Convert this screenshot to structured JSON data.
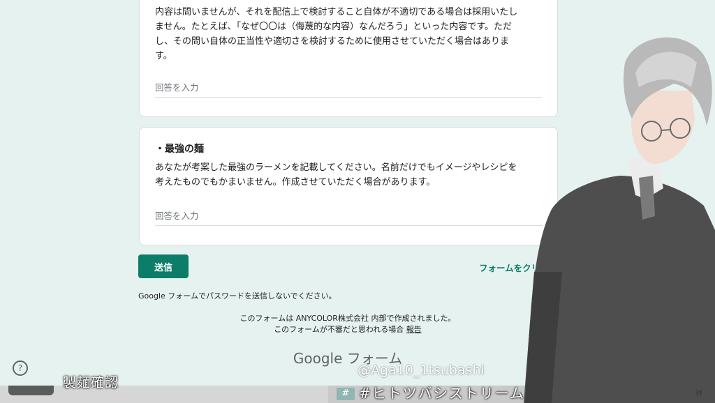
{
  "form": {
    "q1": {
      "text_lines": [
        "内容は問いませんが、それを配信上で検討すること自体が不適切である場合は採用いたし",
        "ません。たとえば、「なぜ〇〇は（侮蔑的な内容）なんだろう」といった内容です。ただ",
        "し、その問い自体の正当性や適切さを検討するために使用させていただく場合はありま",
        "す。"
      ],
      "answer_placeholder": "回答を入力"
    },
    "q2": {
      "title": "・最強の麺",
      "text_lines": [
        "あなたが考案した最強のラーメンを記載してください。名前だけでもイメージやレシピを",
        "考えたものでもかまいません。作成させていただく場合があります。"
      ],
      "answer_placeholder": "回答を入力"
    },
    "submit_label": "送信",
    "clear_label": "フォームをクリア",
    "password_note": "Google フォームでパスワードを送信しないでください。",
    "created_note": "このフォームは ANYCOLOR株式会社 内部で作成されました。",
    "abuse_note": "このフォームが不審だと思われる場合",
    "report_label": "報告",
    "logo_google": "Google",
    "logo_forms": "フォーム"
  },
  "help_icon": "help-circle-icon",
  "overlay": {
    "left_caption": "製麺確認",
    "handle": "@Aga10_1tsubashi",
    "hashtag_badge": "#",
    "hashtag": "#ヒトツバシストリーム",
    "corner_mark": "ﾇｷ"
  },
  "colors": {
    "accent": "#0b7d68",
    "background": "#e6f2ef"
  }
}
